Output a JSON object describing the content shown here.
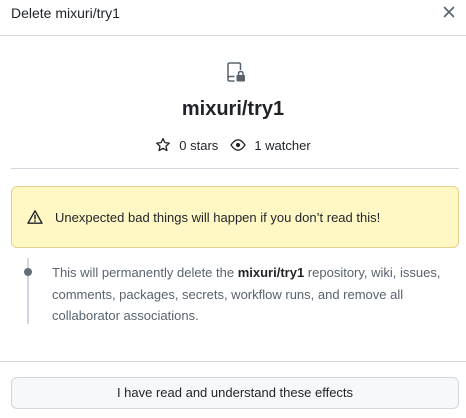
{
  "dialog": {
    "title": "Delete mixuri/try1",
    "close_icon": "x-icon"
  },
  "repo": {
    "icon": "repo-locked-icon",
    "name": "mixuri/try1",
    "stars": "0 stars",
    "watchers": "1 watcher"
  },
  "warning": {
    "icon": "alert-icon",
    "text": "Unexpected bad things will happen if you don’t read this!"
  },
  "detail": {
    "prefix": "This will permanently delete the ",
    "repo": "mixuri/try1",
    "suffix": " repository, wiki, issues, comments, packages, secrets, workflow runs, and remove all collaborator associations."
  },
  "confirm": {
    "label": "I have read and understand these effects"
  },
  "colors": {
    "warning_bg": "#fff8c5",
    "warning_border": "#e3d28a",
    "border": "#d0d7de",
    "muted_text": "#59636e"
  }
}
